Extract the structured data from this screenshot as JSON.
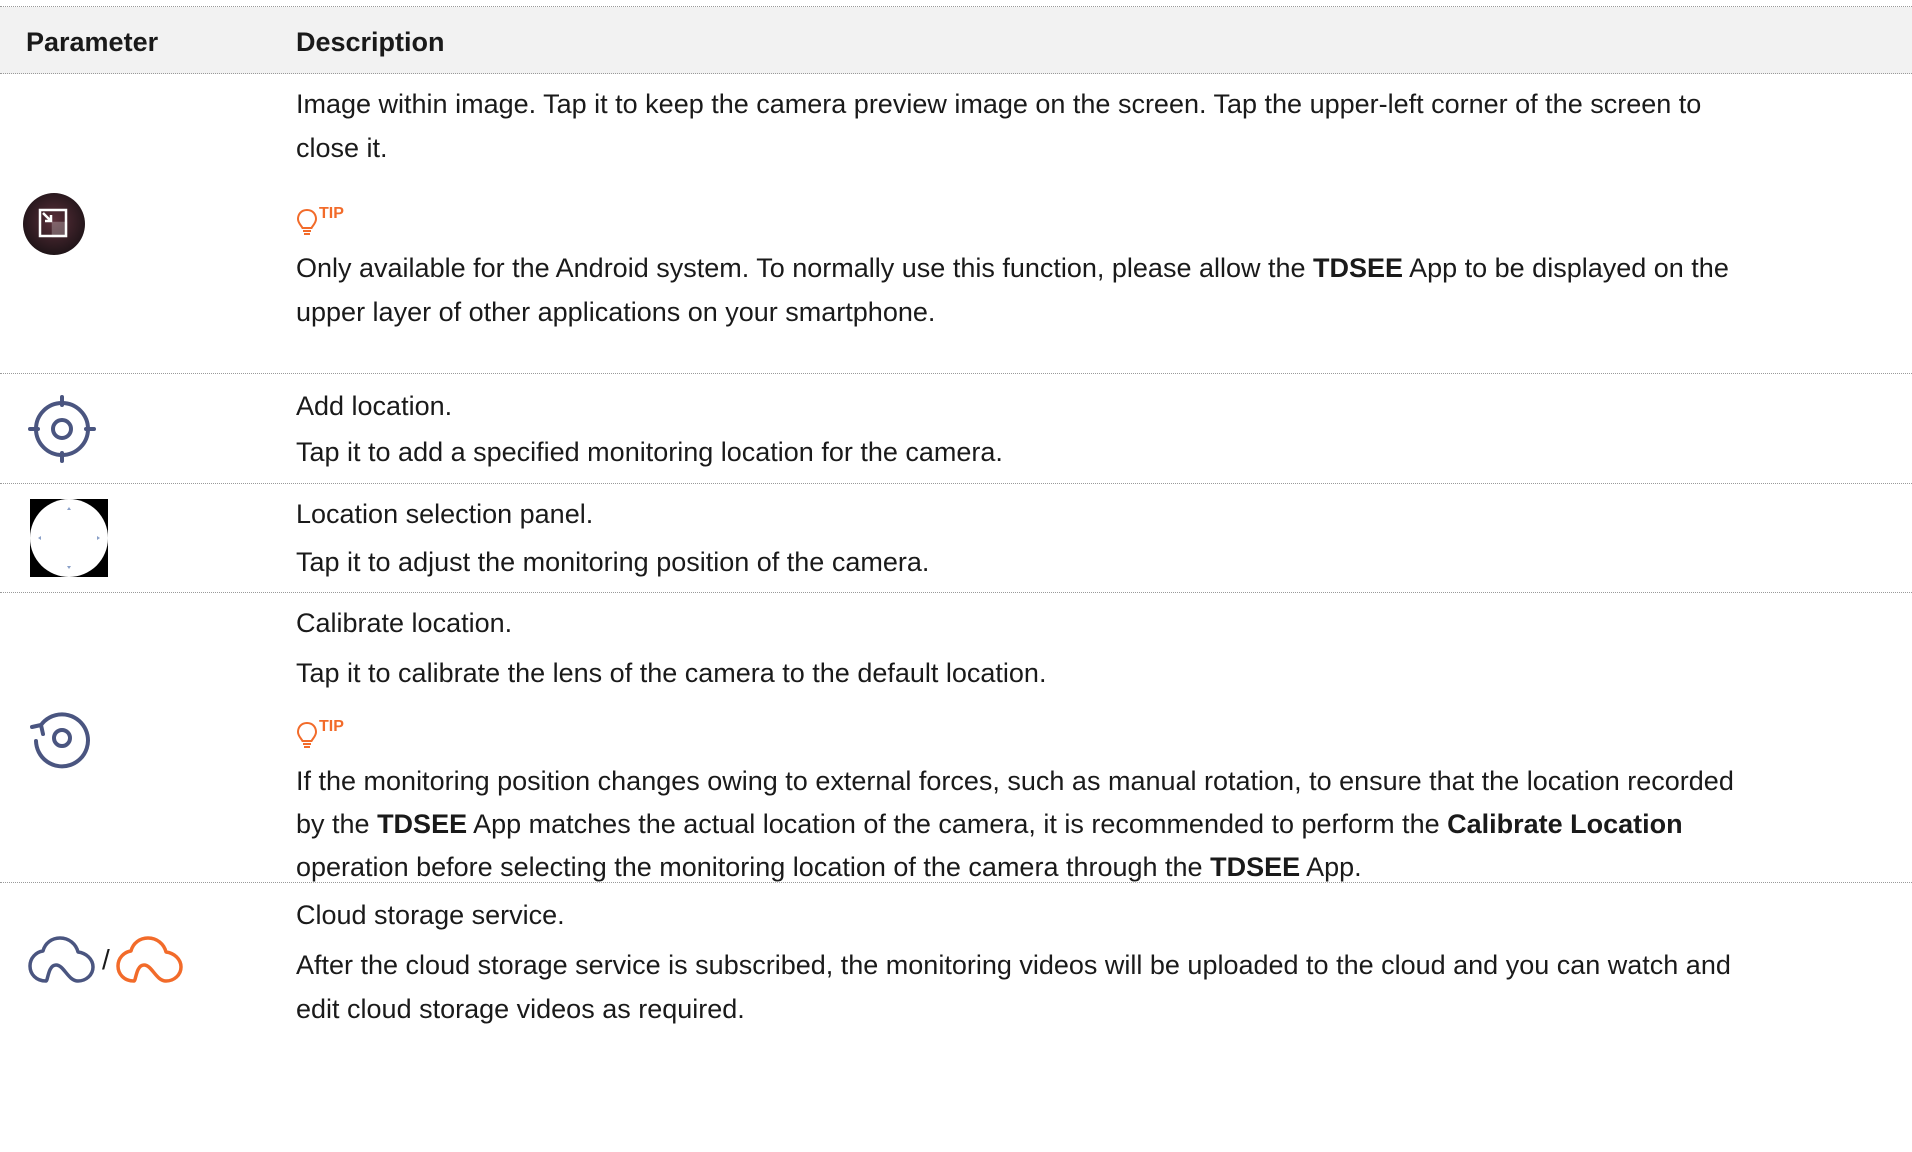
{
  "header": {
    "param": "Parameter",
    "desc": "Description"
  },
  "rows": [
    {
      "line1": "Image within image. Tap it to keep the camera preview image on the screen. Tap the upper-left corner of the screen to",
      "line2": "close it.",
      "tip": "TIP",
      "note_a": "Only available for the Android system. To normally use this function, please allow the ",
      "note_b": "TDSEE",
      "note_c": " App to be displayed on the",
      "note_d": "upper layer of other applications on your smartphone."
    },
    {
      "line1": "Add location.",
      "line2": "Tap it to add a specified monitoring location for the camera."
    },
    {
      "line1": "Location selection panel.",
      "line2": "Tap it to adjust the monitoring position of the camera."
    },
    {
      "line1": "Calibrate location.",
      "line2": "Tap it to calibrate the lens of the camera to the default location.",
      "tip": "TIP",
      "n1": "If the monitoring position changes owing to external forces, such as manual rotation, to ensure that the location recorded",
      "n2a": "by the ",
      "n2b": "TDSEE",
      "n2c": " App matches the actual location of the camera, it is recommended to perform the ",
      "n2d": "Calibrate Location",
      "n3a": "operation before selecting the monitoring location of the camera through the ",
      "n3b": "TDSEE",
      "n3c": " App."
    },
    {
      "line1": "Cloud storage service.",
      "line2": "After the cloud storage service is subscribed, the monitoring videos will be uploaded to the cloud and you can watch and",
      "line3": "edit cloud storage videos as required.",
      "separator": "/"
    }
  ],
  "colors": {
    "icon": "#4a5580",
    "accent": "#f26b2a"
  }
}
